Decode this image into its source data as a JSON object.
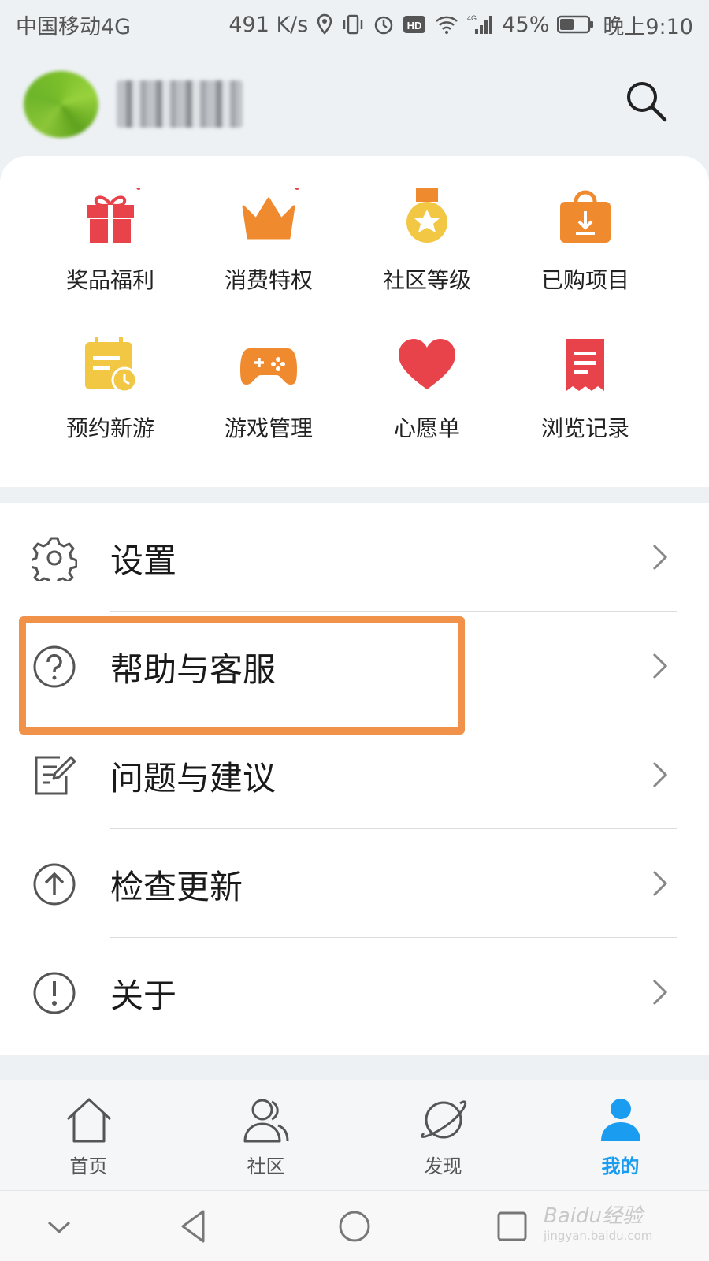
{
  "status_bar": {
    "carrier": "中国移动4G",
    "speed": "491 K/s",
    "network": "4G",
    "battery": "45%",
    "time": "晚上9:10"
  },
  "header": {
    "search_icon": "search-icon"
  },
  "grid": {
    "items": [
      {
        "label": "奖品福利",
        "icon": "gift-icon",
        "color": "#e8434b"
      },
      {
        "label": "消费特权",
        "icon": "crown-icon",
        "color": "#f08a2e"
      },
      {
        "label": "社区等级",
        "icon": "medal-icon",
        "color": "#f2c744"
      },
      {
        "label": "已购项目",
        "icon": "shopping-bag-icon",
        "color": "#f08a2e"
      },
      {
        "label": "预约新游",
        "icon": "calendar-clock-icon",
        "color": "#f2c744"
      },
      {
        "label": "游戏管理",
        "icon": "gamepad-icon",
        "color": "#f08a2e"
      },
      {
        "label": "心愿单",
        "icon": "heart-icon",
        "color": "#e8434b"
      },
      {
        "label": "浏览记录",
        "icon": "receipt-icon",
        "color": "#e8434b"
      }
    ]
  },
  "menu": {
    "items": [
      {
        "label": "设置",
        "icon": "gear-icon"
      },
      {
        "label": "帮助与客服",
        "icon": "question-circle-icon"
      },
      {
        "label": "问题与建议",
        "icon": "edit-note-icon"
      },
      {
        "label": "检查更新",
        "icon": "arrow-up-circle-icon"
      },
      {
        "label": "关于",
        "icon": "exclamation-circle-icon"
      }
    ],
    "highlight_color": "#f0924a"
  },
  "tabbar": {
    "tabs": [
      {
        "label": "首页",
        "icon": "home-icon"
      },
      {
        "label": "社区",
        "icon": "people-icon"
      },
      {
        "label": "发现",
        "icon": "planet-icon"
      },
      {
        "label": "我的",
        "icon": "user-icon",
        "active": true
      }
    ],
    "active_color": "#1a9cf0"
  },
  "watermark": {
    "brand": "Baidu经验",
    "url": "jingyan.baidu.com"
  }
}
